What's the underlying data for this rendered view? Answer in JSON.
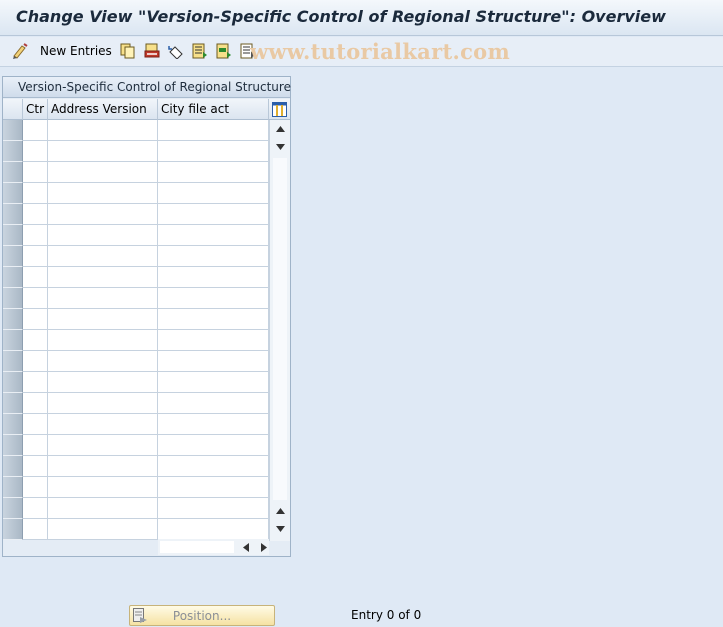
{
  "window": {
    "title": "Change View \"Version-Specific Control of Regional Structure\": Overview"
  },
  "toolbar": {
    "new_entries_label": "New Entries",
    "icons": [
      "pen-icon",
      "copy-icon",
      "delete-icon",
      "undo-icon",
      "select-all-icon",
      "select-block-icon",
      "deselect-all-icon"
    ]
  },
  "watermark": "www.tutorialkart.com",
  "table": {
    "title": "Version-Specific Control of Regional Structure",
    "columns": [
      "Ctr",
      "Address Version",
      "City file act"
    ],
    "row_count": 20,
    "rows": []
  },
  "footer": {
    "position_button_label": "Position...",
    "entry_text": "Entry 0 of 0"
  },
  "colors": {
    "accent": "#dfe9f5",
    "selector": "#b4c1ce",
    "button": "#f5e2a3"
  }
}
